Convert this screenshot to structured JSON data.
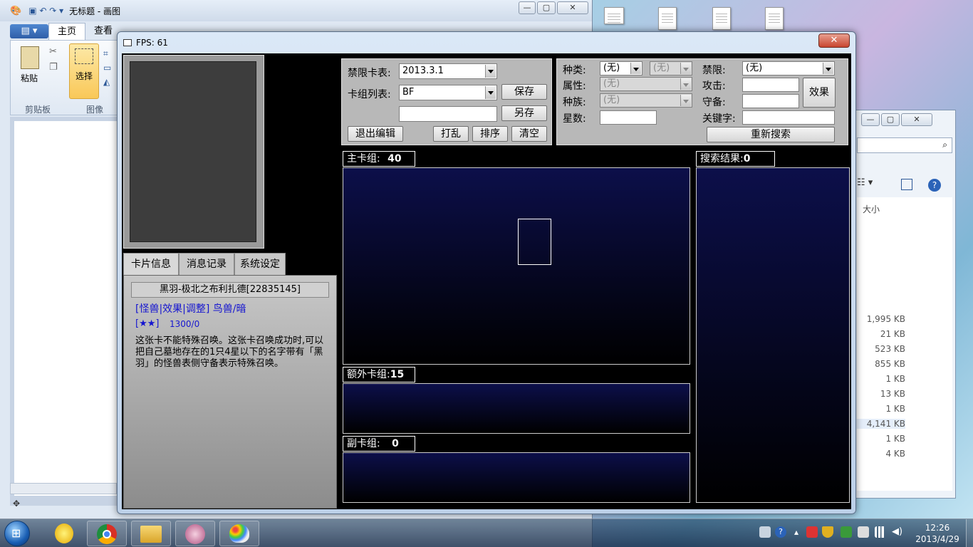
{
  "paint": {
    "title": "无标题 - 画图",
    "tabs": {
      "file_menu": "▤ ▾",
      "home": "主页",
      "view": "查看"
    },
    "groups": {
      "paste": "粘贴",
      "select": "选择",
      "clipboard": "剪贴板",
      "image": "图像"
    }
  },
  "explorer": {
    "size_header": "大小",
    "sizes": [
      "1,995 KB",
      "21 KB",
      "523 KB",
      "855 KB",
      "1 KB",
      "13 KB",
      "1 KB",
      "4,141 KB",
      "1 KB",
      "4 KB"
    ]
  },
  "game": {
    "title": "FPS: 61",
    "close_label": "✕",
    "deck_controls": {
      "banlist_label": "禁限卡表:",
      "banlist_value": "2013.3.1",
      "decklist_label": "卡组列表:",
      "decklist_value": "BF",
      "save": "保存",
      "save_as": "另存",
      "exit_edit": "退出编辑",
      "shuffle": "打乱",
      "sort": "排序",
      "clear": "清空"
    },
    "search": {
      "type_label": "种类:",
      "type_value": "(无)",
      "type2_value": "(无)",
      "attribute_label": "属性:",
      "attribute_value": "(无)",
      "race_label": "种族:",
      "race_value": "(无)",
      "level_label": "星数:",
      "limit_label": "禁限:",
      "limit_value": "(无)",
      "attack_label": "攻击:",
      "defense_label": "守备:",
      "keyword_label": "关键字:",
      "effect_button": "效果",
      "research_button": "重新搜索"
    },
    "decks": {
      "main_label": "主卡组:",
      "main_count": "40",
      "extra_label": "额外卡组:",
      "extra_count": "15",
      "side_label": "副卡组:",
      "side_count": "0",
      "result_label": "搜索结果:",
      "result_count": "0"
    },
    "info_tabs": {
      "card_info": "卡片信息",
      "log": "消息记录",
      "settings": "系统设定"
    },
    "card": {
      "name": "黑羽-极北之布利扎德[22835145]",
      "type_line": "[怪兽|效果|调整] 鸟兽/暗",
      "stars": "[★★]",
      "stats": "1300/0",
      "description": "这张卡不能特殊召唤。这张卡召唤成功时,可以把自己墓地存在的1只4星以下的名字带有「黑羽」的怪兽表侧守备表示特殊召唤。"
    }
  },
  "clock": {
    "time": "12:26",
    "date": "2013/4/29"
  }
}
